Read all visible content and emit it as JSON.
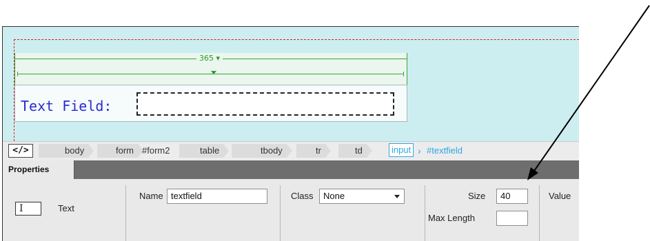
{
  "canvas": {
    "ruler_width": "365",
    "text_field_label": "Text Field:"
  },
  "tag_selector": {
    "tag_button": "</>",
    "crumbs": [
      "body",
      "form",
      "#form2",
      "table",
      "tbody",
      "tr",
      "td",
      "input",
      "#textfield"
    ]
  },
  "properties": {
    "tab_label": "Properties",
    "element_type": "Text",
    "name_label": "Name",
    "name_value": "textfield",
    "class_label": "Class",
    "class_value": "None",
    "size_label": "Size",
    "size_value": "40",
    "max_length_label": "Max Length",
    "max_length_value": "",
    "value_label": "Value"
  },
  "icons": [
    "text-field-icon",
    "dropdown-arrow-icon",
    "annotation-arrow"
  ],
  "colors": {
    "canvas_bg": "#cdeef0",
    "label_blue": "#2a2ad1",
    "ruler_green": "#3aa33a",
    "tag_active": "#2fa7e0"
  }
}
